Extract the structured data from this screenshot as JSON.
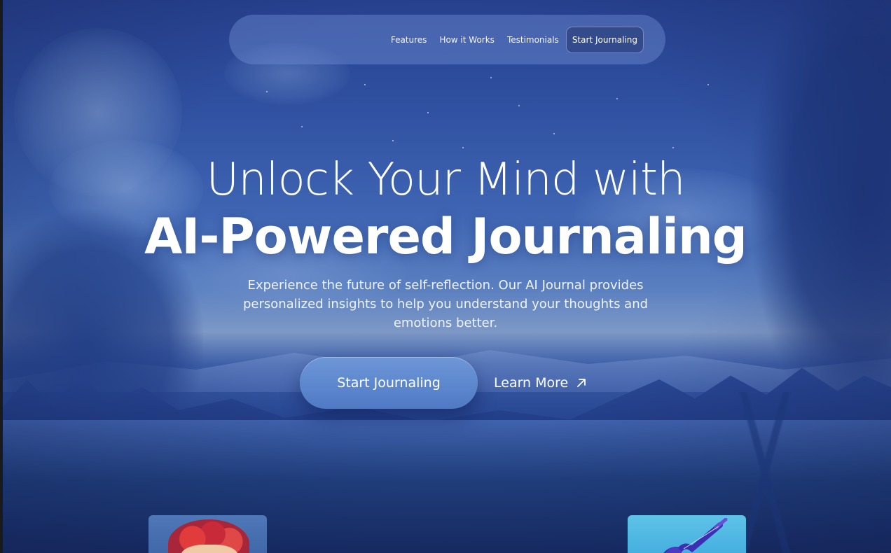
{
  "nav": {
    "links": [
      "Features",
      "How it Works",
      "Testimonials"
    ],
    "cta_label": "Start Journaling"
  },
  "hero": {
    "title_line1": "Unlock Your Mind with",
    "title_line2": "AI-Powered Journaling",
    "subtitle": "Experience the future of self-reflection. Our AI Journal provides personalized insights to help you understand your thoughts and emotions better.",
    "primary_cta": "Start Journaling",
    "secondary_cta": "Learn More"
  },
  "icons": {
    "secondary_cta_icon": "arrow-up-right-icon"
  },
  "colors": {
    "nav_bg": "#6e8cd2",
    "primary_cta": "#5a84cc",
    "card_left": "#4f78b8",
    "card_right": "#5ec3e8"
  }
}
